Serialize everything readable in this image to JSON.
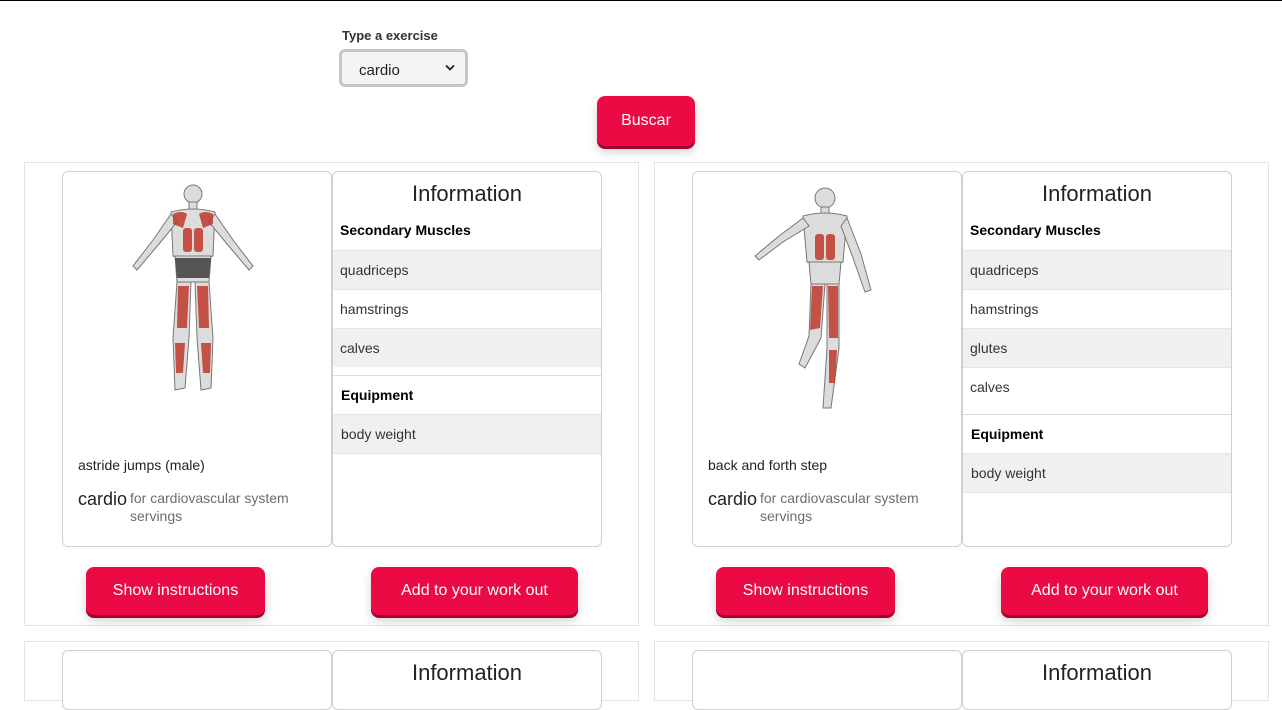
{
  "filter": {
    "label": "Type a exercise",
    "selected": "cardio"
  },
  "search_button": "Buscar",
  "cards": [
    {
      "name": "astride jumps (male)",
      "category": "cardio",
      "description": "for cardiovascular system servings",
      "info_title": "Information",
      "secondary_title": "Secondary Muscles",
      "secondary_muscles": [
        "quadriceps",
        "hamstrings",
        "calves"
      ],
      "equipment_title": "Equipment",
      "equipment": "body weight",
      "instructions_button": "Show instructions",
      "add_button": "Add to your work out"
    },
    {
      "name": "back and forth step",
      "category": "cardio",
      "description": "for cardiovascular system servings",
      "info_title": "Information",
      "secondary_title": "Secondary Muscles",
      "secondary_muscles": [
        "quadriceps",
        "hamstrings",
        "glutes",
        "calves"
      ],
      "equipment_title": "Equipment",
      "equipment": "body weight",
      "instructions_button": "Show instructions",
      "add_button": "Add to your work out"
    },
    {
      "info_title": "Information"
    },
    {
      "info_title": "Information"
    }
  ],
  "colors": {
    "accent": "#ec0a44",
    "muscle_highlight": "#c0392b"
  },
  "icons": {
    "select_arrow": "chevron-down-icon",
    "exercise_figure": "exercise-figure-icon"
  }
}
